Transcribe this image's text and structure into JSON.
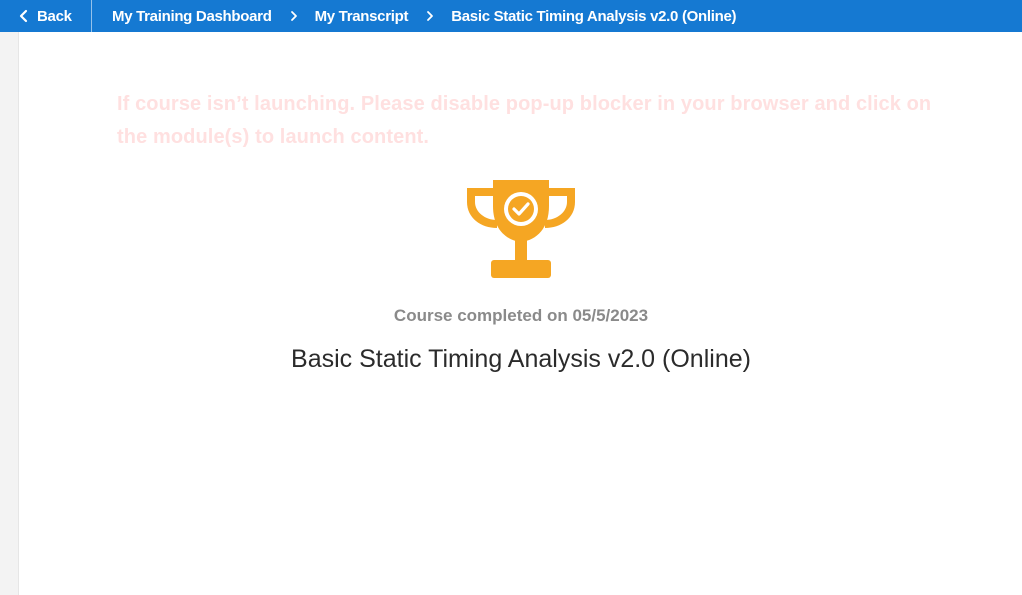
{
  "header": {
    "back_label": "Back",
    "breadcrumb": {
      "dashboard": "My Training Dashboard",
      "transcript": "My Transcript",
      "current": "Basic Static Timing Analysis v2.0 (Online)"
    }
  },
  "main": {
    "notice": "If course isn’t launching. Please disable pop-up blocker in your browser and click on the module(s) to launch content.",
    "completed_text": "Course completed on 05/5/2023",
    "course_title": "Basic Static Timing Analysis v2.0 (Online)",
    "trophy_icon": "trophy-check-icon"
  },
  "colors": {
    "header_bg": "#1579d2",
    "trophy": "#f5a623",
    "notice_text": "#ffe0e0"
  }
}
